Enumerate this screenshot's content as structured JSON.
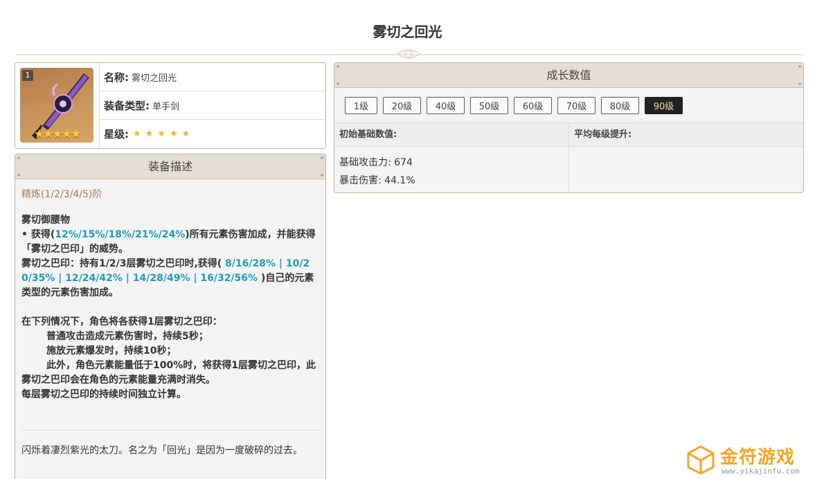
{
  "page": {
    "title": "雾切之回光"
  },
  "info": {
    "refine_badge": "1",
    "weapon_stars": "★★★★★",
    "name_key": "名称:",
    "name_val": "雾切之回光",
    "type_key": "装备类型:",
    "type_val": "单手剑",
    "star_key": "星级:",
    "stars": [
      "★",
      "★",
      "★",
      "★",
      "★"
    ]
  },
  "desc": {
    "header": "装备描述",
    "refine_label": "精炼(1/2/3/4/5)阶",
    "passive_name": "雾切御腰物",
    "p1_a": "• 获得(",
    "p1_hl": "12%/15%/18%/21%/24%",
    "p1_b": ")所有元素伤害加成，并能获得「雾切之巴印」的威势。",
    "p2_a": "雾切之巴印：持有1/2/3层雾切之巴印时,获得( ",
    "p2_hl": "8/16/28% | 10/20/35% | 12/24/42% | 14/28/49% | 16/32/56%",
    "p2_b": " )自己的元素类型的元素伤害加成。",
    "p3": "在下列情况下，角色将各获得1层雾切之巴印：",
    "p4": "普通攻击造成元素伤害时，持续5秒；",
    "p5": "施放元素爆发时，持续10秒；",
    "p6": "此外，角色元素能量低于100%时，将获得1层雾切之巴印，此雾切之巴印会在角色的元素能量充满时消失。",
    "p7": "每层雾切之巴印的持续时间独立计算。",
    "lore": "闪烁着凄烈紫光的太刀。名之为「回光」是因为一度破碎的过去。"
  },
  "growth": {
    "header": "成长数值",
    "levels": [
      "1级",
      "20级",
      "40级",
      "50级",
      "60级",
      "70级",
      "80级",
      "90级"
    ],
    "active_level": "90级",
    "col_base": "初始基础数值:",
    "col_avg": "平均每级提升:",
    "stat_atk": "基础攻击力: 674",
    "stat_crit": "暴击伤害: 44.1%"
  },
  "watermark": {
    "brand": "金符游戏",
    "url": "www.yikajinfu.com"
  },
  "colors": {
    "accent": "#1e9ac4",
    "refine": "#a27d58",
    "star": "#f3b51c",
    "header_bg": "#e6ddd4",
    "active_btn": "#222222",
    "brand": "#f5a623"
  }
}
